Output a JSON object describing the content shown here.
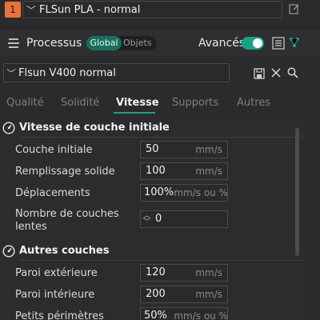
{
  "filament": {
    "index": "1",
    "preset": "FLSun PLA - normal"
  },
  "process": {
    "title": "Processus",
    "scope_global": "Global",
    "scope_objects": "Objets",
    "advanced_label": "Avancés",
    "advanced_on": true
  },
  "preset": {
    "name": "Flsun V400 normal"
  },
  "tabs": [
    {
      "label": "Qualité",
      "active": false
    },
    {
      "label": "Solidité",
      "active": false
    },
    {
      "label": "Vitesse",
      "active": true
    },
    {
      "label": "Supports",
      "active": false
    },
    {
      "label": "Autres",
      "active": false
    }
  ],
  "sections": [
    {
      "title": "Vitesse de couche initiale",
      "rows": [
        {
          "label": "Couche initiale",
          "value": "50",
          "unit": "mm/s"
        },
        {
          "label": "Remplissage solide",
          "value": "100",
          "unit": "mm/s"
        },
        {
          "label": "Déplacements",
          "value": "100%",
          "unit": "mm/s ou %"
        },
        {
          "label_line1": "Nombre de couches",
          "label_line2": "lentes",
          "value": "0",
          "unit": ""
        }
      ]
    },
    {
      "title": "Autres couches",
      "rows": [
        {
          "label": "Paroi extérieure",
          "value": "120",
          "unit": "mm/s"
        },
        {
          "label": "Paroi intérieure",
          "value": "200",
          "unit": "mm/s"
        },
        {
          "label": "Petits périmètres",
          "value": "50%",
          "unit": "mm/s ou %"
        }
      ]
    }
  ],
  "colors": {
    "accent": "#1aa184",
    "filament_badge": "#e8733a",
    "background": "#2b2b2e"
  },
  "icons": [
    "edit-icon",
    "process-icon",
    "list-icon",
    "network-icon",
    "save-icon",
    "close-icon",
    "search-icon",
    "speedometer-icon",
    "stepper-icon"
  ]
}
